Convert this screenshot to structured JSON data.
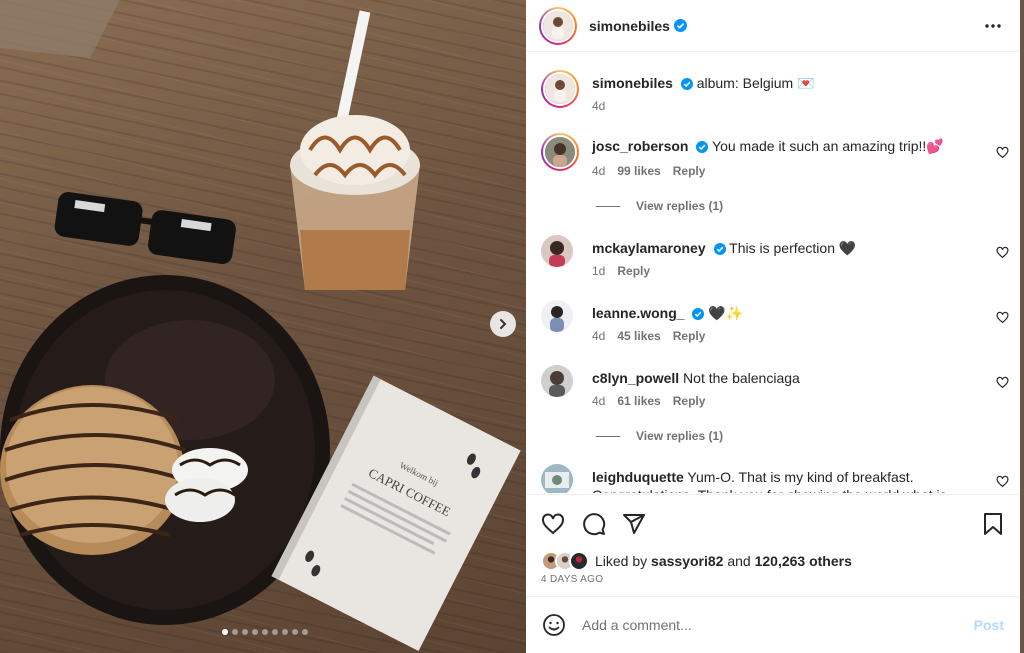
{
  "post": {
    "author": "simonebiles",
    "caption": "album: Belgium 💌",
    "caption_time": "4d"
  },
  "photo": {
    "slide_count": 9,
    "active_slide": 1,
    "next_icon": "chevron-right-icon"
  },
  "comments": [
    {
      "user": "josc_roberson",
      "verified": true,
      "text": "You made it such an amazing trip!!💕",
      "time": "4d",
      "likes": "99 likes",
      "reply": "Reply",
      "view_replies": "View replies (1)"
    },
    {
      "user": "mckaylamaroney",
      "verified": true,
      "text": "This is perfection 🖤",
      "time": "1d",
      "reply": "Reply"
    },
    {
      "user": "leanne.wong_",
      "verified": true,
      "text": "🖤✨",
      "time": "4d",
      "likes": "45 likes",
      "reply": "Reply"
    },
    {
      "user": "c8lyn_powell",
      "verified": false,
      "text": "Not the balenciaga",
      "time": "4d",
      "likes": "61 likes",
      "reply": "Reply",
      "view_replies": "View replies (1)"
    },
    {
      "user": "leighduquette",
      "verified": false,
      "text": "Yum-O. That is my kind of breakfast. Congratulations. Thank you for showing the world what is"
    }
  ],
  "liked_by": {
    "prefix": "Liked by",
    "user": "sassyori82",
    "middle": "and",
    "others": "120,263 others"
  },
  "post_date": "4 DAYS AGO",
  "add_comment": {
    "placeholder": "Add a comment...",
    "post_label": "Post"
  },
  "colors": {
    "verified": "#0095f6",
    "post_disabled": "#b3dbff",
    "muted": "#737373"
  }
}
